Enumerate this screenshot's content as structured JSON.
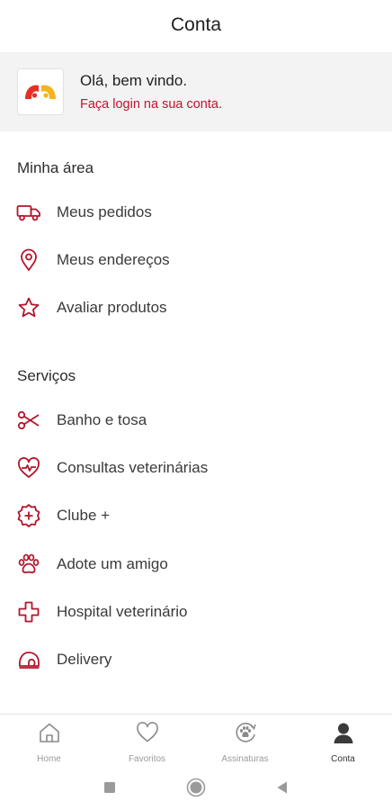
{
  "header": {
    "title": "Conta"
  },
  "login_card": {
    "greeting": "Olá, bem vindo.",
    "login_link": "Faça login na sua conta."
  },
  "sections": {
    "my_area": {
      "title": "Minha área",
      "items": [
        {
          "label": "Meus pedidos",
          "icon": "truck-icon"
        },
        {
          "label": "Meus endereços",
          "icon": "location-pin-icon"
        },
        {
          "label": "Avaliar produtos",
          "icon": "star-icon"
        }
      ]
    },
    "services": {
      "title": "Serviços",
      "items": [
        {
          "label": "Banho e tosa",
          "icon": "scissors-icon"
        },
        {
          "label": "Consultas veterinárias",
          "icon": "heart-pulse-icon"
        },
        {
          "label": "Clube +",
          "icon": "badge-plus-icon"
        },
        {
          "label": "Adote um amigo",
          "icon": "paw-icon"
        },
        {
          "label": "Hospital veterinário",
          "icon": "cross-icon"
        },
        {
          "label": "Delivery",
          "icon": "delivery-helmet-icon"
        }
      ]
    }
  },
  "bottom_nav": {
    "items": [
      {
        "label": "Home",
        "icon": "home-icon",
        "active": false
      },
      {
        "label": "Favoritos",
        "icon": "heart-icon",
        "active": false
      },
      {
        "label": "Assinaturas",
        "icon": "subscription-paw-icon",
        "active": false
      },
      {
        "label": "Conta",
        "icon": "user-icon",
        "active": true
      }
    ]
  },
  "system_nav": [
    "recents-button",
    "home-button",
    "back-button"
  ],
  "colors": {
    "accent": "#c8102e",
    "icon_red": "#b5152b",
    "card_bg": "#f3f3f3",
    "logo_red": "#e63027",
    "logo_yellow": "#f2b51d"
  }
}
